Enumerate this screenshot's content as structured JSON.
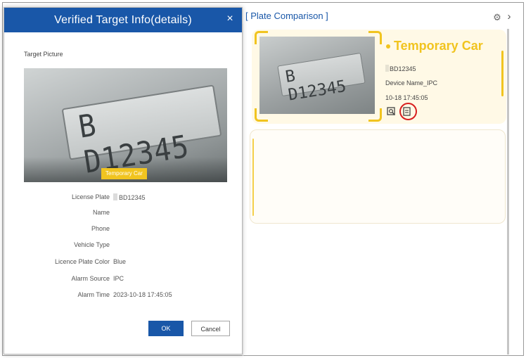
{
  "dialog": {
    "title": "Verified Target Info(details)",
    "close_glyph": "×",
    "target_picture_label": "Target Picture",
    "plate_image_text": "B D12345",
    "plate_tag": "Temporary Car",
    "fields": [
      {
        "label": "License Plate",
        "value": "BD12345"
      },
      {
        "label": "Name",
        "value": ""
      },
      {
        "label": "Phone",
        "value": ""
      },
      {
        "label": "Vehicle Type",
        "value": ""
      },
      {
        "label": "Licence Plate Color",
        "value": "Blue"
      },
      {
        "label": "Alarm Source",
        "value": "IPC"
      },
      {
        "label": "Alarm Time",
        "value": "2023-10-18 17:45:05"
      }
    ],
    "ok_label": "OK",
    "cancel_label": "Cancel"
  },
  "panel": {
    "title": "[ Plate Comparison ]",
    "settings_icon": "gear-icon",
    "expand_icon": "chevron-right-icon",
    "card": {
      "title": "Temporary Car",
      "plate_image_text": "B D12345",
      "plate": "BD12345",
      "device": "Device Name_IPC",
      "time": "10-18 17:45:05",
      "icons": [
        "search-image-icon",
        "details-icon"
      ]
    }
  },
  "colors": {
    "dialog_header": "#1957a8",
    "accent_yellow": "#f1c41f",
    "highlight_red": "#d81f1f",
    "title_blue": "#1957a8"
  }
}
